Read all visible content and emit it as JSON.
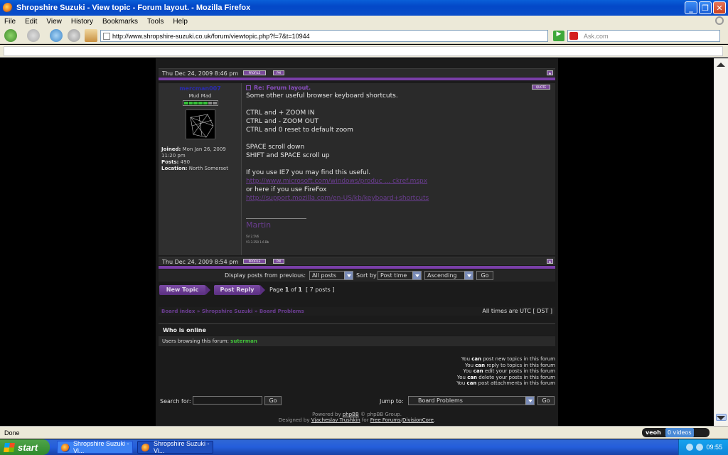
{
  "window": {
    "title": "Shropshire Suzuki - View topic - Forum layout. - Mozilla Firefox"
  },
  "menu": [
    "File",
    "Edit",
    "View",
    "History",
    "Bookmarks",
    "Tools",
    "Help"
  ],
  "nav": {
    "url": "http://www.shropshire-suzuki.co.uk/forum/viewtopic.php?f=7&t=10944",
    "search_placeholder": "Ask.com"
  },
  "prev_post": {
    "date": "Thu Dec 24, 2009 8:46 pm",
    "profile_label": "PROFILE",
    "pm_label": "PM"
  },
  "post": {
    "username": "mercman007",
    "rank": "Mud Mad",
    "joined_label": "Joined:",
    "joined": "Mon Jan 26, 2009 11:20 pm",
    "posts_label": "Posts:",
    "posts": "490",
    "location_label": "Location:",
    "location": "North Somerset",
    "title": "Re: Forum layout.",
    "quote_label": "QUOTE",
    "lines": {
      "l1": "Some other useful browser keyboard shortcuts.",
      "l2": "CTRL and + ZOOM IN",
      "l3": "CTRL and - ZOOM OUT",
      "l4": "CTRL and 0 reset to default zoom",
      "l5": "SPACE scroll down",
      "l6": "SHIFT and SPACE scroll up",
      "l7": "If you use IE7 you may find this useful.",
      "link1": "http://www.microsoft.com/windows/produc ... ckref.mspx",
      "l8": "or here if you use FireFox",
      "link2": "http://support.mozilla.com/en-US/kb/keyboard+shortcuts"
    },
    "sig_name": "Martin",
    "sig_line1": "SV 2.5V6",
    "sig_line2": "V1 3.250 1.6 Bb",
    "date": "Thu Dec 24, 2009 8:54 pm",
    "profile_label": "PROFILE",
    "pm_label": "PM"
  },
  "display": {
    "label": "Display posts from previous:",
    "period": "All posts",
    "sort_label": "Sort by",
    "sort": "Post time",
    "order": "Ascending",
    "go": "Go"
  },
  "actions": {
    "new_topic": "New Topic",
    "post_reply": "Post Reply"
  },
  "pagination": {
    "page": "Page",
    "current": "1",
    "of": "of",
    "total": "1",
    "posts": "[ 7 posts ]"
  },
  "breadcrumb": {
    "crumbs": "Board index » Shropshire Suzuki » Board Problems",
    "times": "All times are UTC [ DST ]"
  },
  "online": {
    "heading": "Who is online",
    "browsing": "Users browsing this forum:",
    "user": "suterman"
  },
  "permissions": {
    "p1": {
      "pre": "You ",
      "can": "can",
      "post": " post new topics in this forum"
    },
    "p2": {
      "pre": "You ",
      "can": "can",
      "post": " reply to topics in this forum"
    },
    "p3": {
      "pre": "You ",
      "can": "can",
      "post": " edit your posts in this forum"
    },
    "p4": {
      "pre": "You ",
      "can": "can",
      "post": " delete your posts in this forum"
    },
    "p5": {
      "pre": "You ",
      "can": "can",
      "post": " post attachments in this forum"
    }
  },
  "search": {
    "label": "Search for:",
    "go": "Go"
  },
  "jump": {
    "label": "Jump to:",
    "value": "Board Problems",
    "go": "Go"
  },
  "footer": {
    "powered_pre": "Powered by ",
    "phpbb": "phpBB",
    "powered_post": " © phpBB Group.",
    "designed_pre": "Designed by ",
    "designer": "Vjacheslav Trushkin",
    "for": " for ",
    "free_forums": "Free Forums",
    "slash": "/",
    "division": "DivisionCore",
    "dot": "."
  },
  "status": {
    "text": "Done",
    "veoh": "veoh",
    "videos": "0 videos"
  },
  "taskbar": {
    "start": "start",
    "task1": "Shropshire Suzuki - Vi...",
    "task2": "Shropshire Suzuki - Vi...",
    "time": "09:55"
  },
  "colors": {
    "accent_purple": "#7a3fa8",
    "online_green": "#41c23a"
  }
}
